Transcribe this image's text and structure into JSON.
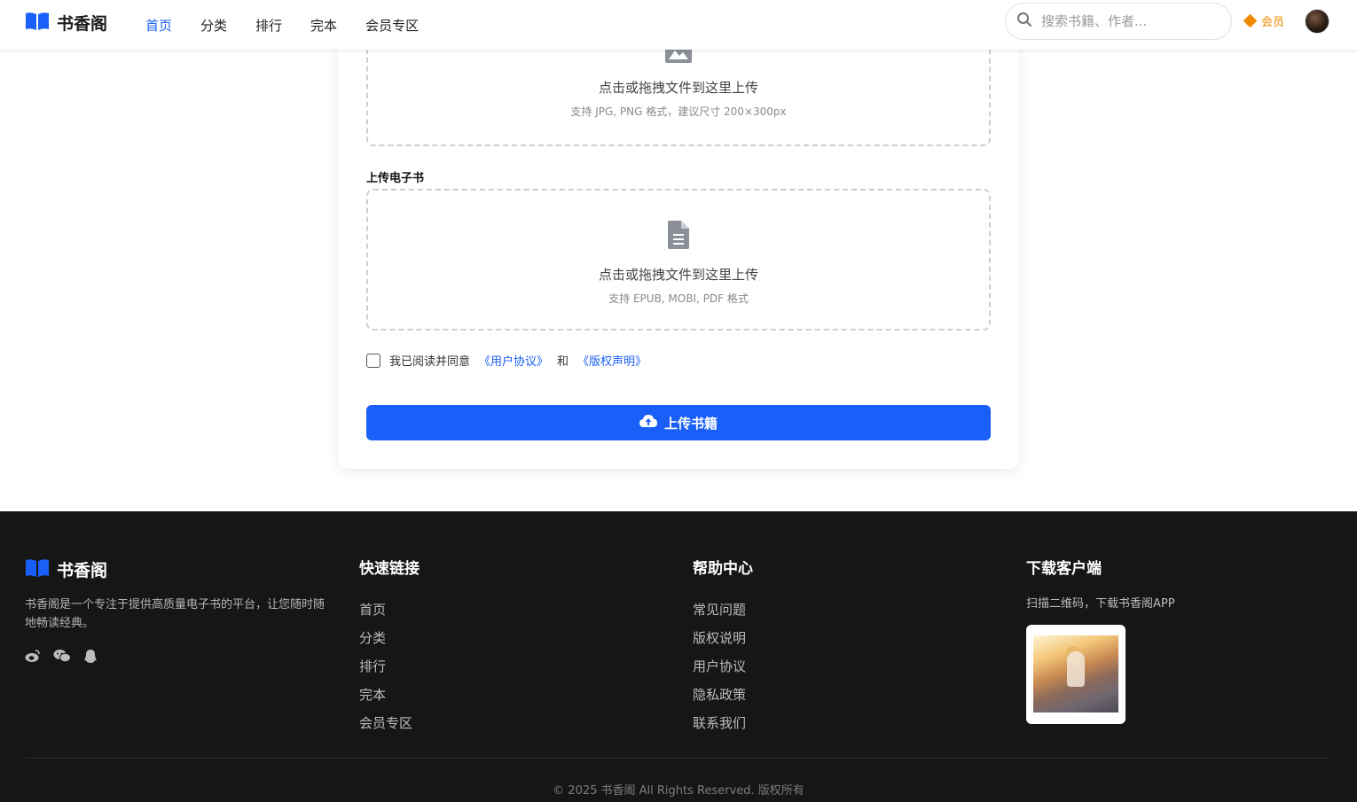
{
  "header": {
    "logo_text": "书香阁",
    "nav": [
      {
        "label": "首页",
        "active": true
      },
      {
        "label": "分类",
        "active": false
      },
      {
        "label": "排行",
        "active": false
      },
      {
        "label": "完本",
        "active": false
      },
      {
        "label": "会员专区",
        "active": false
      }
    ],
    "search_placeholder": "搜索书籍、作者...",
    "vip_label": "会员"
  },
  "upload": {
    "cover_zone": {
      "title": "点击或拖拽文件到这里上传",
      "hint": "支持 JPG, PNG 格式，建议尺寸 200×300px",
      "icon": "image-icon"
    },
    "ebook_label": "上传电子书",
    "ebook_zone": {
      "title": "点击或拖拽文件到这里上传",
      "hint": "支持 EPUB, MOBI, PDF 格式",
      "icon": "file-text-icon"
    },
    "agree_prefix": "我已阅读并同意",
    "agree_link1": "《用户协议》",
    "agree_and": "和",
    "agree_link2": "《版权声明》",
    "submit_label": "上传书籍",
    "submit_icon": "cloud-upload-icon"
  },
  "footer": {
    "logo_text": "书香阁",
    "description": "书香阁是一个专注于提供高质量电子书的平台，让您随时随地畅读经典。",
    "social": [
      "weibo-icon",
      "wechat-icon",
      "qq-icon"
    ],
    "quick_links": {
      "title": "快速链接",
      "items": [
        "首页",
        "分类",
        "排行",
        "完本",
        "会员专区"
      ]
    },
    "help": {
      "title": "帮助中心",
      "items": [
        "常见问题",
        "版权说明",
        "用户协议",
        "隐私政策",
        "联系我们"
      ]
    },
    "download": {
      "title": "下载客户端",
      "note": "扫描二维码，下载书香阁APP"
    },
    "copyright": "© 2025 书香阁 All Rights Reserved. 版权所有"
  },
  "colors": {
    "accent": "#1a5ff7",
    "vip": "#f08a00",
    "footer_bg": "#161616"
  }
}
